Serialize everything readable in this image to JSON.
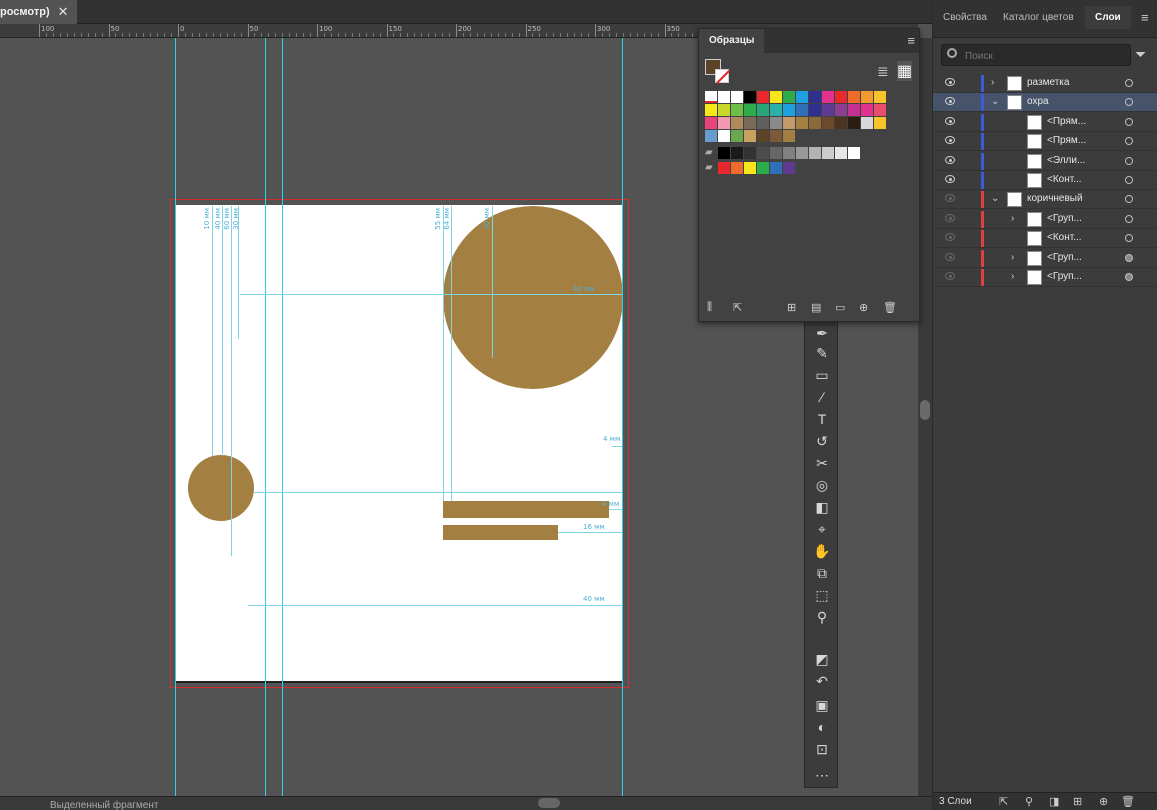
{
  "document": {
    "tab_title": "росмотр)",
    "close_glyph": "✕"
  },
  "ruler": {
    "labels": [
      "100",
      "50",
      "0",
      "50",
      "100",
      "150",
      "200",
      "250",
      "300",
      "350"
    ]
  },
  "artboard": {
    "shape_color": "#a37f42",
    "measurements": {
      "left_vertical": [
        "10 мм",
        "40 мм",
        "60 мм",
        "30 мм"
      ],
      "top_vertical": [
        "55 мм",
        "64 мм",
        "30 мм"
      ],
      "circle_radius": "40 мм",
      "right_gap": "4 мм",
      "bar_gap": "4 мм",
      "bar_offset": "16 мм",
      "bottom_width": "40 мм"
    }
  },
  "status": {
    "text": "Выделенный фрагмент"
  },
  "swatches": {
    "tab": "Образцы",
    "menu_glyph": "≡",
    "view_list_glyph": "≣",
    "view_grid_glyph": "▦",
    "fill_color": "#5b4327",
    "rows": [
      [
        "none",
        "#ffffff",
        "#ffffff",
        "#000000",
        "#e8282d",
        "#f6e61a",
        "#2eab4a",
        "#1ea0e0",
        "#2f3190",
        "#e2318f",
        "#e8282d",
        "#ef6b2d",
        "#f39b2d",
        "#f7c42b"
      ],
      [
        "#f6e61a",
        "#c9d62a",
        "#6fbe45",
        "#2eab4a",
        "#2aa57a",
        "#2ab0a8",
        "#1ea0e0",
        "#2e6fb7",
        "#2f3190",
        "#5f3a92",
        "#8d3d92",
        "#c2318f",
        "#e2318f",
        "#e84e6b"
      ],
      [
        "#e8437a",
        "#f29ab0",
        "#b08a5a",
        "#7a6a58",
        "#5e5e5e",
        "#8a8a8a",
        "#c49a6a",
        "#a37f42",
        "#8a6a3a",
        "#6a4a2a",
        "#4a3420",
        "#2a1e14",
        "#d8d8d8",
        "#f7c42b"
      ],
      [
        "#6a9bd0",
        "#ffffff",
        "#6aa84f",
        "#c8a060",
        "#5b4327",
        "#7a5a3a",
        "#a37f42"
      ]
    ],
    "gray_row": [
      "#000000",
      "#1a1a1a",
      "#333333",
      "#4d4d4d",
      "#666666",
      "#808080",
      "#999999",
      "#b3b3b3",
      "#cccccc",
      "#e6e6e6",
      "#ffffff"
    ],
    "color_row": [
      "#e8282d",
      "#ef6b2d",
      "#f6e61a",
      "#2eab4a",
      "#2e6fb7",
      "#5f3a92"
    ],
    "footer_glyphs": [
      "⫼",
      "⇱",
      "⊞",
      "▤",
      "▭",
      "⊕",
      "🗑"
    ]
  },
  "toolbar": {
    "tools": [
      "✒",
      "✎",
      "▭",
      "∕",
      "T",
      "↺",
      "✂",
      "◎",
      "◧",
      "⌖",
      "✋",
      "⧉",
      "⬚",
      "⚲",
      "◩",
      "↶",
      "▣",
      "◐",
      "⊡",
      "⋯"
    ]
  },
  "right_panel": {
    "tabs": [
      "Свойства",
      "Каталог цветов",
      "Слои"
    ],
    "menu_glyph": "≡",
    "search_placeholder": "Поиск",
    "filter_glyph": "⏷",
    "layers": [
      {
        "name": "разметка",
        "level": 0,
        "color": "#3b5bd9",
        "visible": true,
        "expanded": false
      },
      {
        "name": "охра",
        "level": 0,
        "color": "#3b5bd9",
        "visible": true,
        "expanded": true,
        "selected": true
      },
      {
        "name": "<Прям...",
        "level": 1,
        "color": "#3b5bd9",
        "visible": true
      },
      {
        "name": "<Прям...",
        "level": 1,
        "color": "#3b5bd9",
        "visible": true
      },
      {
        "name": "<Элли...",
        "level": 1,
        "color": "#3b5bd9",
        "visible": true
      },
      {
        "name": "<Конт...",
        "level": 1,
        "color": "#3b5bd9",
        "visible": true
      },
      {
        "name": "коричневый",
        "level": 0,
        "color": "#e04040",
        "visible": false,
        "expanded": true
      },
      {
        "name": "<Груп...",
        "level": 1,
        "color": "#e04040",
        "visible": false,
        "expanded": false
      },
      {
        "name": "<Конт...",
        "level": 1,
        "color": "#e04040",
        "visible": false
      },
      {
        "name": "<Груп...",
        "level": 1,
        "color": "#e04040",
        "visible": false,
        "expanded": false,
        "filled": true
      },
      {
        "name": "<Груп...",
        "level": 1,
        "color": "#e04040",
        "visible": false,
        "expanded": false,
        "filled": true
      }
    ],
    "footer": {
      "count": "3 Слои",
      "glyphs": [
        "⇱",
        "⚲",
        "◨",
        "⊞",
        "⊕",
        "🗑"
      ]
    }
  }
}
